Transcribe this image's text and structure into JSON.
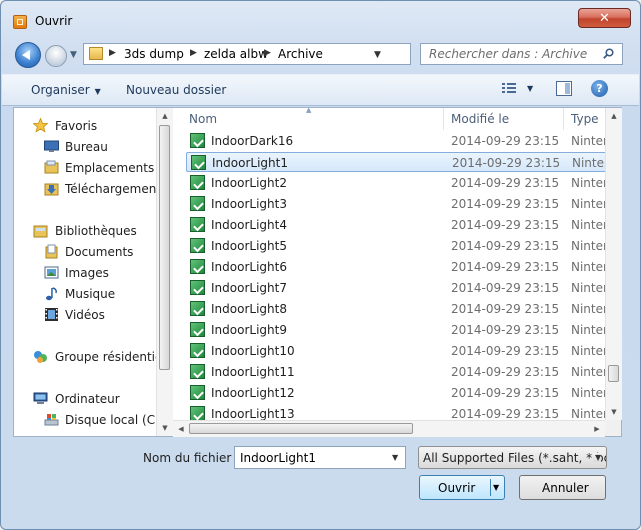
{
  "window": {
    "title": "Ouvrir",
    "close_label": "✕"
  },
  "address_bar": {
    "crumbs": [
      "3ds dump",
      "zelda albw",
      "Archive"
    ],
    "search_placeholder": "Rechercher dans : Archive"
  },
  "toolbar": {
    "organize_label": "Organiser",
    "new_folder_label": "Nouveau dossier",
    "help_label": "?"
  },
  "nav": {
    "items": [
      {
        "label": "Favoris",
        "icon": "star-icon"
      },
      {
        "label": "Bureau",
        "icon": "desktop-icon"
      },
      {
        "label": "Emplacements récents",
        "icon": "recent-places-icon"
      },
      {
        "label": "Téléchargements",
        "icon": "downloads-icon"
      },
      {
        "label": "Bibliothèques",
        "icon": "libraries-icon"
      },
      {
        "label": "Documents",
        "icon": "documents-icon"
      },
      {
        "label": "Images",
        "icon": "pictures-icon"
      },
      {
        "label": "Musique",
        "icon": "music-icon"
      },
      {
        "label": "Vidéos",
        "icon": "videos-icon"
      },
      {
        "label": "Groupe résidentiel",
        "icon": "homegroup-icon"
      },
      {
        "label": "Ordinateur",
        "icon": "computer-icon"
      },
      {
        "label": "Disque local (C:)",
        "icon": "local-disk-icon"
      }
    ]
  },
  "columns": {
    "name": "Nom",
    "modified": "Modifié le",
    "type": "Type"
  },
  "files": [
    {
      "name": "IndoorDark16",
      "modified": "2014-09-29 23:15",
      "type": "Ninten"
    },
    {
      "name": "IndoorLight1",
      "modified": "2014-09-29 23:15",
      "type": "Ninten"
    },
    {
      "name": "IndoorLight2",
      "modified": "2014-09-29 23:15",
      "type": "Ninten"
    },
    {
      "name": "IndoorLight3",
      "modified": "2014-09-29 23:15",
      "type": "Ninten"
    },
    {
      "name": "IndoorLight4",
      "modified": "2014-09-29 23:15",
      "type": "Ninten"
    },
    {
      "name": "IndoorLight5",
      "modified": "2014-09-29 23:15",
      "type": "Ninten"
    },
    {
      "name": "IndoorLight6",
      "modified": "2014-09-29 23:15",
      "type": "Ninten"
    },
    {
      "name": "IndoorLight7",
      "modified": "2014-09-29 23:15",
      "type": "Ninten"
    },
    {
      "name": "IndoorLight8",
      "modified": "2014-09-29 23:15",
      "type": "Ninten"
    },
    {
      "name": "IndoorLight9",
      "modified": "2014-09-29 23:15",
      "type": "Ninten"
    },
    {
      "name": "IndoorLight10",
      "modified": "2014-09-29 23:15",
      "type": "Ninten"
    },
    {
      "name": "IndoorLight11",
      "modified": "2014-09-29 23:15",
      "type": "Ninten"
    },
    {
      "name": "IndoorLight12",
      "modified": "2014-09-29 23:15",
      "type": "Ninten"
    },
    {
      "name": "IndoorLight13",
      "modified": "2014-09-29 23:15",
      "type": "Ninten"
    }
  ],
  "selected_file_index": 1,
  "filename": {
    "label": "Nom du fichier :",
    "value": "IndoorLight1"
  },
  "filter": {
    "value": "All Supported Files (*.saht, *.bcs"
  },
  "buttons": {
    "open": "Ouvrir",
    "cancel": "Annuler"
  }
}
